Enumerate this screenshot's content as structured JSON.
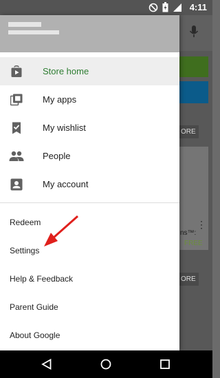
{
  "status_bar": {
    "time": "4:11"
  },
  "drawer": {
    "nav_items": [
      {
        "label": "Store home",
        "icon": "play-store-icon",
        "active": true
      },
      {
        "label": "My apps",
        "icon": "my-apps-icon"
      },
      {
        "label": "My wishlist",
        "icon": "bookmark-check-icon"
      },
      {
        "label": "People",
        "icon": "people-icon"
      },
      {
        "label": "My account",
        "icon": "account-box-icon"
      }
    ],
    "text_items": [
      {
        "label": "Redeem"
      },
      {
        "label": "Settings"
      },
      {
        "label": "Help & Feedback"
      },
      {
        "label": "Parent Guide"
      },
      {
        "label": "About Google"
      }
    ]
  },
  "background": {
    "more_chip_1": "ORE",
    "more_chip_2": "ORE",
    "card_text": "ns™:",
    "free_label": "FREE"
  },
  "colors": {
    "active_label": "#2e7d32",
    "annotation_arrow": "#e0201c",
    "drawer_header": "#b1b1b1"
  }
}
